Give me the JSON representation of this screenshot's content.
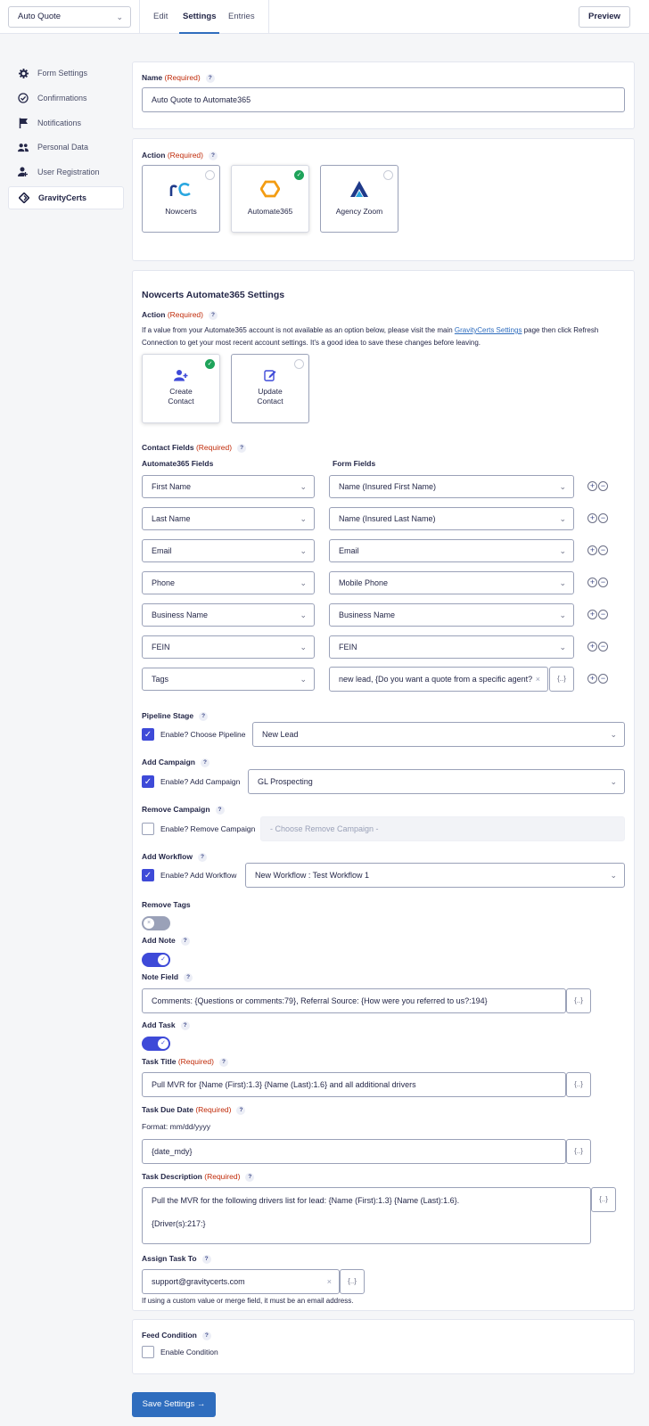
{
  "topbar": {
    "form_name": "Auto Quote",
    "tabs": [
      "Edit",
      "Settings",
      "Entries"
    ],
    "preview": "Preview"
  },
  "sidebar": {
    "items": [
      {
        "label": "Form Settings",
        "icon": "gear-icon"
      },
      {
        "label": "Confirmations",
        "icon": "check-circle-icon"
      },
      {
        "label": "Notifications",
        "icon": "flag-icon"
      },
      {
        "label": "Personal Data",
        "icon": "users-icon"
      },
      {
        "label": "User Registration",
        "icon": "user-add-icon"
      },
      {
        "label": "GravityCerts",
        "icon": "gravitycerts-icon"
      }
    ]
  },
  "name_panel": {
    "label": "Name",
    "required": "(Required)",
    "value": "Auto Quote to Automate365"
  },
  "action_panel": {
    "label": "Action",
    "required": "(Required)",
    "tiles": [
      {
        "label": "Nowcerts",
        "selected": false
      },
      {
        "label": "Automate365",
        "selected": true
      },
      {
        "label": "Agency Zoom",
        "selected": false
      }
    ]
  },
  "settings": {
    "title": "Nowcerts Automate365 Settings",
    "action_label": "Action",
    "action_required": "(Required)",
    "help_before": "If a value from your Automate365 account is not available as an option below, please visit the main ",
    "help_link": "GravityCerts Settings",
    "help_after": " page then click Refresh Connection to get your most recent account settings. It's a good idea to save these changes before leaving.",
    "action_tiles": [
      {
        "line1": "Create",
        "line2": "Contact",
        "selected": true
      },
      {
        "line1": "Update",
        "line2": "Contact",
        "selected": false
      }
    ],
    "contact_fields_label": "Contact Fields",
    "contact_fields_required": "(Required)",
    "col_left": "Automate365 Fields",
    "col_right": "Form Fields",
    "rows": [
      {
        "a": "First Name",
        "f": "Name (Insured First Name)"
      },
      {
        "a": "Last Name",
        "f": "Name (Insured Last Name)"
      },
      {
        "a": "Email",
        "f": "Email"
      },
      {
        "a": "Phone",
        "f": "Mobile Phone"
      },
      {
        "a": "Business Name",
        "f": "Business Name"
      },
      {
        "a": "FEIN",
        "f": "FEIN"
      },
      {
        "a": "Tags",
        "f": "new lead, {Do you want a quote from a specific agent?"
      }
    ],
    "pipeline": {
      "label": "Pipeline Stage",
      "check_label": "Enable? Choose Pipeline",
      "value": "New Lead",
      "checked": true
    },
    "add_campaign": {
      "label": "Add Campaign",
      "check_label": "Enable? Add Campaign",
      "value": "GL Prospecting",
      "checked": true
    },
    "remove_campaign": {
      "label": "Remove Campaign",
      "check_label": "Enable? Remove Campaign",
      "placeholder": "- Choose Remove Campaign -",
      "checked": false
    },
    "add_workflow": {
      "label": "Add Workflow",
      "check_label": "Enable? Add Workflow",
      "value": "New Workflow : Test Workflow 1",
      "checked": true
    },
    "remove_tags": {
      "label": "Remove Tags",
      "on": false
    },
    "add_note": {
      "label": "Add Note",
      "on": true
    },
    "note_field": {
      "label": "Note Field",
      "value": "Comments: {Questions or comments:79}, Referral Source: {How were you referred to us?:194}"
    },
    "add_task": {
      "label": "Add Task",
      "on": true
    },
    "task_title": {
      "label": "Task Title",
      "required": "(Required)",
      "value": "Pull MVR for {Name (First):1.3} {Name (Last):1.6} and all additional drivers"
    },
    "task_due": {
      "label": "Task Due Date",
      "required": "(Required)",
      "format": "Format: mm/dd/yyyy",
      "value": "{date_mdy}"
    },
    "task_desc": {
      "label": "Task Description",
      "required": "(Required)",
      "line1": "Pull the MVR for the following drivers list for lead: {Name (First):1.3} {Name (Last):1.6}.",
      "line2": "{Driver(s):217:}"
    },
    "assign": {
      "label": "Assign Task To",
      "value": "support@gravitycerts.com",
      "help": "If using a custom value or merge field, it must be an email address."
    }
  },
  "feed_condition": {
    "label": "Feed Condition",
    "check_label": "Enable Condition",
    "checked": false
  },
  "save": "Save Settings →",
  "merge_tag": "{..}",
  "colors": {
    "accent": "#3e4ad8",
    "primary_button": "#2f6dbe",
    "required": "#c02b0a",
    "selected_check": "#1ea35a"
  }
}
